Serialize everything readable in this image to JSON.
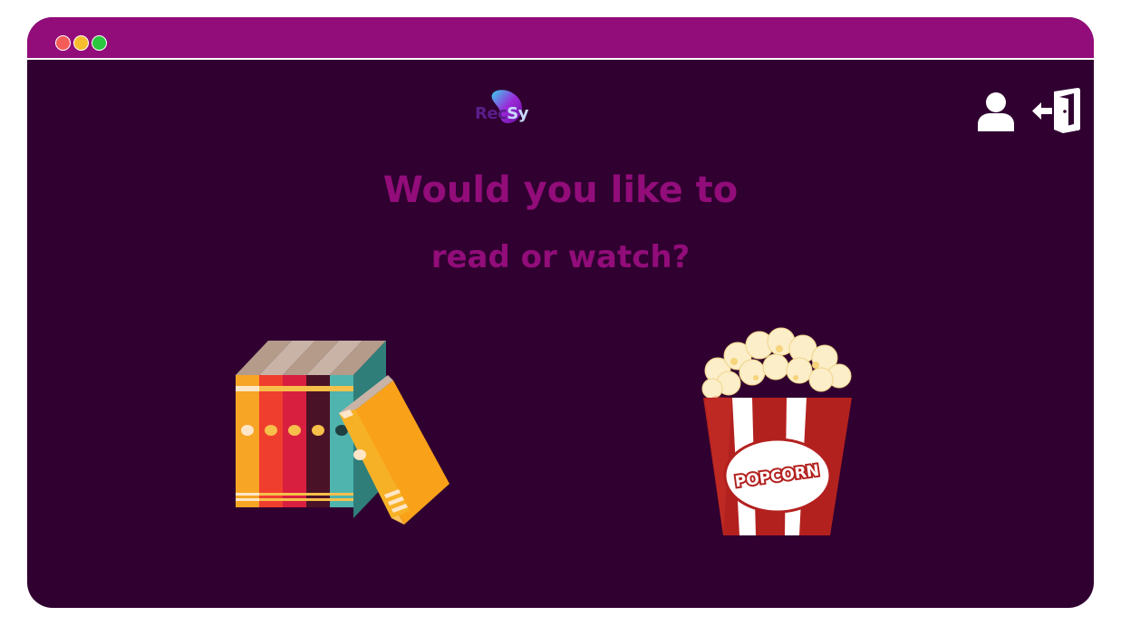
{
  "window": {
    "controls": [
      "close",
      "minimize",
      "maximize"
    ]
  },
  "header": {
    "logo_part1": "Rec",
    "logo_part2": "Sy",
    "user_icon": "user-icon",
    "logout_icon": "logout-icon"
  },
  "main": {
    "headline_line1": "Would you like to",
    "headline_line2": "read or watch?",
    "options": [
      {
        "name": "books",
        "icon": "books-icon"
      },
      {
        "name": "movies",
        "icon": "popcorn-icon",
        "label": "POPCORN"
      }
    ]
  },
  "colors": {
    "titlebar": "#920c7a",
    "background": "#300030",
    "headline": "#920c7a"
  }
}
